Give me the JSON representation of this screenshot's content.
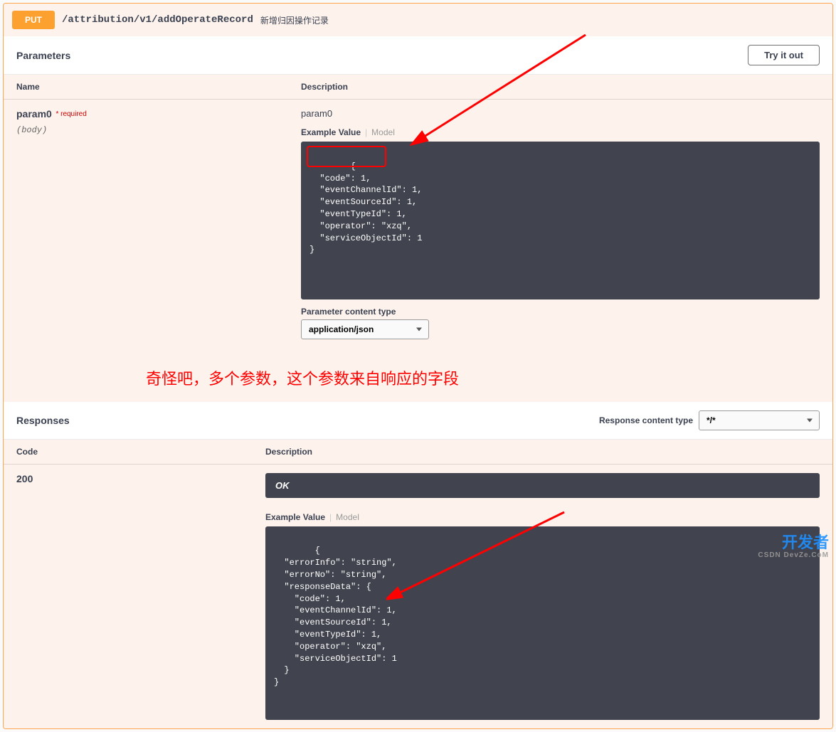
{
  "endpoint": {
    "method": "PUT",
    "path": "/attribution/v1/addOperateRecord",
    "summary": "新增归因操作记录"
  },
  "sections": {
    "parameters_title": "Parameters",
    "responses_title": "Responses",
    "try_it_out": "Try it out",
    "response_content_type_label": "Response content type"
  },
  "columns": {
    "name": "Name",
    "description": "Description",
    "code": "Code"
  },
  "param": {
    "name": "param0",
    "required_marker": "* required",
    "in": "(body)",
    "desc_label": "param0",
    "tabs": {
      "example": "Example Value",
      "model": "Model"
    },
    "example_code": "{\n  \"code\": 1,\n  \"eventChannelId\": 1,\n  \"eventSourceId\": 1,\n  \"eventTypeId\": 1,\n  \"operator\": \"xzq\",\n  \"serviceObjectId\": 1\n}",
    "content_type_label": "Parameter content type",
    "content_type_value": "application/json"
  },
  "annotation_text": "奇怪吧，多个参数，这个参数来自响应的字段",
  "response": {
    "code": "200",
    "status": "OK",
    "tabs": {
      "example": "Example Value",
      "model": "Model"
    },
    "example_code": "{\n  \"errorInfo\": \"string\",\n  \"errorNo\": \"string\",\n  \"responseData\": {\n    \"code\": 1,\n    \"eventChannelId\": 1,\n    \"eventSourceId\": 1,\n    \"eventTypeId\": 1,\n    \"operator\": \"xzq\",\n    \"serviceObjectId\": 1\n  }\n}",
    "content_type_value": "*/*"
  },
  "watermark": {
    "line1": "开发者",
    "line2": "CSDN DevZe.CoM"
  }
}
